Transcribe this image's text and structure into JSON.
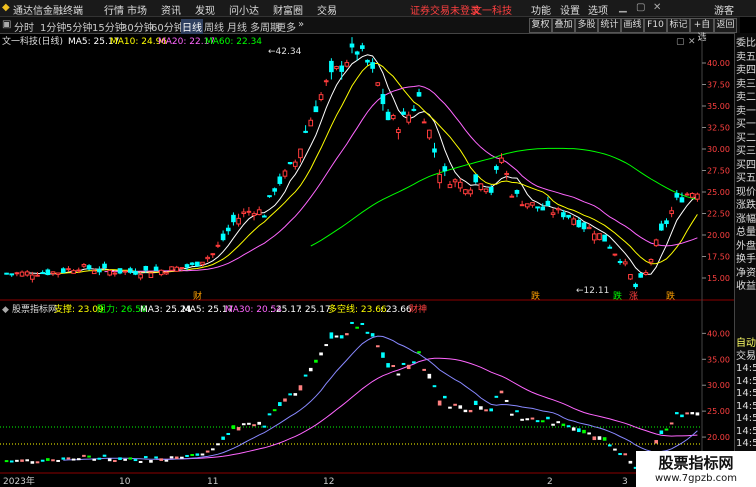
{
  "menubar": {
    "app_name": "通达信金融终端",
    "items": [
      "行情",
      "市场",
      "资讯",
      "发现",
      "问小达",
      "财富圈",
      "交易"
    ],
    "notice": "证券交易未登录",
    "stock_name": "文一科技",
    "right_items": [
      "功能",
      "设置",
      "选项"
    ],
    "guest": "游客"
  },
  "toolbar": {
    "periods": [
      "分时",
      "1分钟",
      "5分钟",
      "15分钟",
      "30分钟",
      "60分钟",
      "日线",
      "周线",
      "月线",
      "多周期",
      "更多"
    ],
    "active_period": "日线",
    "buttons": [
      "复权",
      "叠加",
      "多股",
      "统计",
      "画线",
      "F10",
      "标记",
      "+自选",
      "返回"
    ]
  },
  "main_chart": {
    "title": "文一科技(日线)",
    "ma5_label": "MA5: 25.17",
    "ma10_label": "MA10: 24.96",
    "ma20_label": "MA20: 22.17",
    "ma60_label": "MA60: 22.34",
    "high_label": "42.34",
    "low_label": "12.11",
    "tags": [
      "财",
      "跌",
      "跌",
      "涨",
      "跌"
    ],
    "y_ticks": [
      "40.00",
      "37.50",
      "35.00",
      "32.50",
      "30.00",
      "27.50",
      "25.00",
      "22.50",
      "20.00",
      "17.50",
      "15.00"
    ]
  },
  "sub_chart": {
    "title": "股票指标网",
    "support_label": "支撑: 23.09",
    "resist_label": "阻力: 26.56",
    "ma3_label": "MA3: 25.24",
    "ma5_label": "MA5: 25.17",
    "ma30_label": "MA30: 20.54",
    "val1": ": 25.17",
    "val2": ": 25.17",
    "dkx_label": "多空线: 23.66",
    "val3": ": 23.66",
    "wealth_label": "财神",
    "y_ticks": [
      "40.00",
      "35.00",
      "30.00",
      "25.00",
      "20.00"
    ]
  },
  "x_axis": {
    "labels": [
      "2023年",
      "10",
      "11",
      "12",
      "2",
      "3"
    ]
  },
  "right_panel": {
    "top_items": [
      "委比",
      "卖五",
      "卖四",
      "卖三",
      "卖二",
      "卖一",
      "买一",
      "买二",
      "买三",
      "买四",
      "买五",
      "现价",
      "涨跌",
      "涨幅",
      "总量",
      "外盘",
      "换手",
      "净资",
      "收益"
    ],
    "bottom_items": [
      "自动",
      "交易",
      "14:5",
      "14:5",
      "14:5",
      "14:5",
      "14:5",
      "14:5",
      "14:5",
      "14:5",
      "14:5"
    ]
  },
  "watermark": {
    "title": "股票指标网",
    "url": "www.7gpzb.com"
  },
  "colors": {
    "up": "#ff3c3c",
    "down": "#00ffff",
    "ma5": "#ffffff",
    "ma10": "#ffff00",
    "ma20": "#ff66ff",
    "ma60": "#00ff00",
    "support": "#ffff00",
    "resist": "#00ff00",
    "ma30": "#ff66ff",
    "dkx": "#ffff00"
  }
}
